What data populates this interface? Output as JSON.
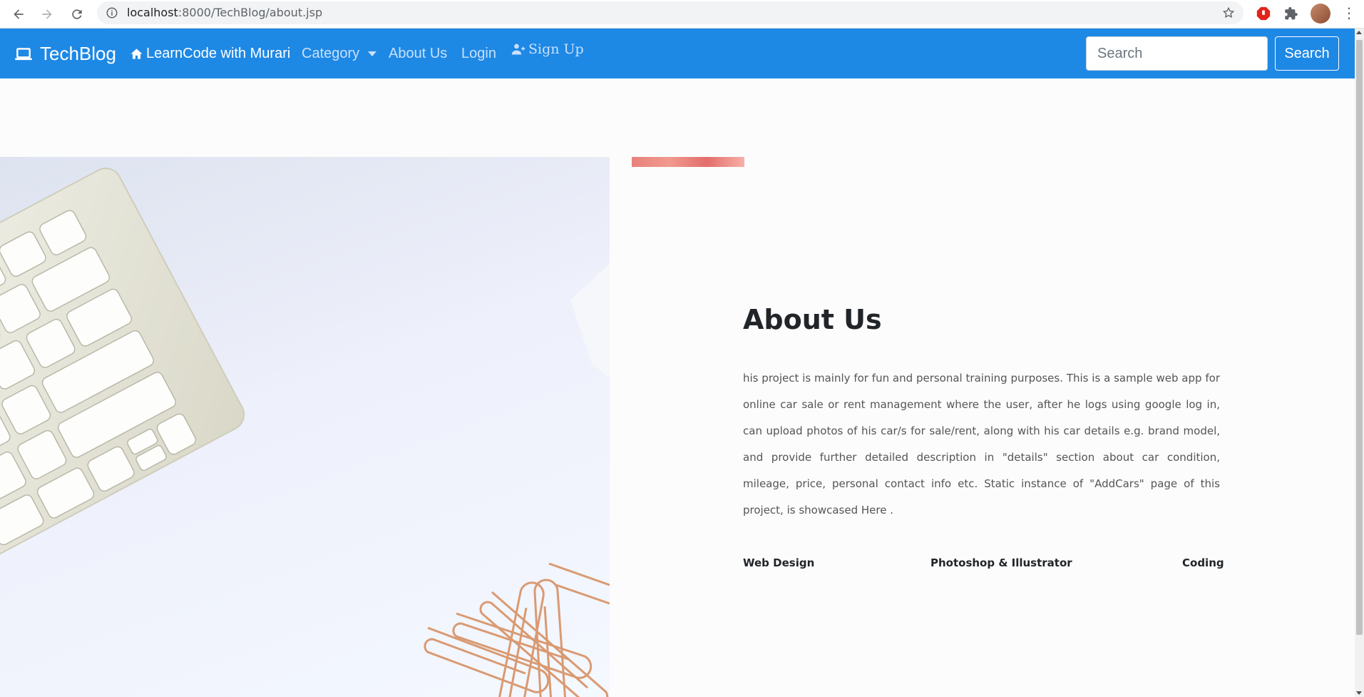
{
  "browser": {
    "url_host": "localhost",
    "url_path": ":8000/TechBlog/about.jsp"
  },
  "navbar": {
    "brand": "TechBlog",
    "links": [
      {
        "label": "LearnCode with Murari",
        "active": true
      },
      {
        "label": "Category"
      },
      {
        "label": "About Us"
      },
      {
        "label": "Login"
      },
      {
        "label": "Sign Up"
      }
    ],
    "search_placeholder": "Search",
    "search_button": "Search"
  },
  "about": {
    "title": "About Us",
    "body": "his project is mainly for fun and personal training purposes. This is a sample web app for online car sale or rent management where the user, after he logs using google log in, can upload photos of his car/s for sale/rent, along with his car details e.g. brand model, and provide further detailed description in \"details\" section about car condition, mileage, price, personal contact info etc. Static instance of \"AddCars\" page of this project, is showcased Here .",
    "skills": [
      "Web Design",
      "Photoshop & Illustrator",
      "Coding"
    ]
  },
  "colors": {
    "navbar": "#1e88e5",
    "text": "#212529"
  }
}
